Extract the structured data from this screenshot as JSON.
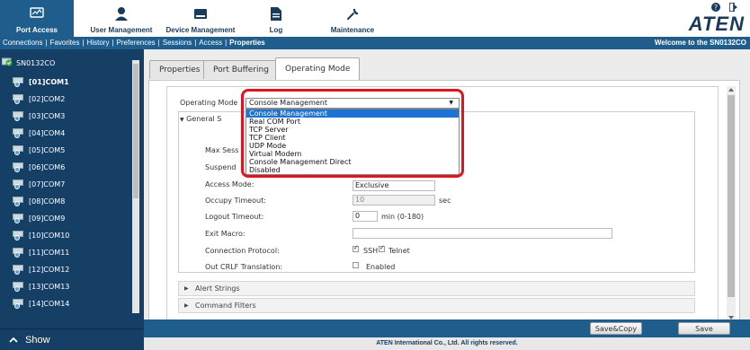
{
  "topnav": {
    "items": [
      {
        "label": "Port Access",
        "icon": "monitor-chart-icon"
      },
      {
        "label": "User Management",
        "icon": "user-icon"
      },
      {
        "label": "Device Management",
        "icon": "device-icon"
      },
      {
        "label": "Log",
        "icon": "document-icon"
      },
      {
        "label": "Maintenance",
        "icon": "wrench-icon"
      }
    ],
    "logo": "ATEN"
  },
  "subnav": {
    "links": [
      "Connections",
      "Favorites",
      "History",
      "Preferences",
      "Sessions",
      "Access",
      "Properties"
    ],
    "welcome": "Welcome to the SN0132CO"
  },
  "sidebar": {
    "root": "SN0132CO",
    "ports": [
      "[01]COM1",
      "[02]COM2",
      "[03]COM3",
      "[04]COM4",
      "[05]COM5",
      "[06]COM6",
      "[07]COM7",
      "[08]COM8",
      "[09]COM9",
      "[10]COM10",
      "[11]COM11",
      "[12]COM12",
      "[13]COM13",
      "[14]COM14"
    ],
    "show_label": "Show"
  },
  "tabs": [
    "Properties",
    "Port Buffering",
    "Operating Mode"
  ],
  "operating_mode": {
    "label": "Operating Mode",
    "value": "Console Management",
    "options": [
      "Console Management",
      "Real COM Port",
      "TCP Server",
      "TCP Client",
      "UDP Mode",
      "Virtual Modem",
      "Console Management Direct",
      "Disabled"
    ]
  },
  "general": {
    "title": "General S",
    "max_sessions_label": "Max Sess",
    "suspend_label": "Suspend",
    "access_mode_label": "Access Mode:",
    "access_mode_value": "Exclusive",
    "occupy_timeout_label": "Occupy Timeout:",
    "occupy_timeout_value": "10",
    "occupy_unit": "sec",
    "logout_timeout_label": "Logout Timeout:",
    "logout_timeout_value": "0",
    "logout_unit": "min (0-180)",
    "exit_macro_label": "Exit Macro:",
    "exit_macro_value": "",
    "conn_protocol_label": "Connection Protocol:",
    "ssh_label": "SSH",
    "telnet_label": "Telnet",
    "crlf_label": "Out CRLF Translation:",
    "crlf_enabled_label": "Enabled"
  },
  "sections": [
    "Alert Strings",
    "Command Filters"
  ],
  "buttons": {
    "save_copy": "Save&Copy",
    "save": "Save"
  },
  "footer": "ATEN International Co., Ltd. All rights reserved."
}
